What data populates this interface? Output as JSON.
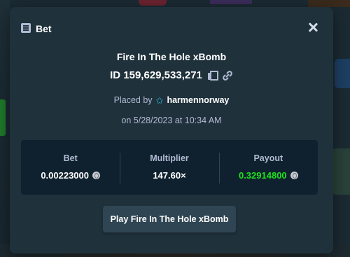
{
  "modal": {
    "title": "Bet",
    "game_name": "Fire In The Hole xBomb",
    "bet_id": "ID 159,629,533,271",
    "placed_by_prefix": "Placed by",
    "username": "harmennorway",
    "date_text": "on 5/28/2023 at 10:34 AM"
  },
  "stats": [
    {
      "label": "Bet",
      "value": "0.00223000",
      "icon": "coin-icon"
    },
    {
      "label": "Multiplier",
      "value": "147.60×"
    },
    {
      "label": "Payout",
      "value": "0.32914800",
      "icon": "coin-icon"
    }
  ],
  "play_button_label": "Play Fire In The Hole xBomb",
  "colors": {
    "modal_bg": "#1f313b",
    "stats_bg": "#0f212e",
    "muted_text": "#b1bad3",
    "payout_green": "#1fe11f",
    "star_blue": "#2ab6df",
    "button_bg": "#2f4553"
  },
  "icons": [
    "bet-slip-icon",
    "close-icon",
    "copy-icon",
    "link-icon",
    "star-icon",
    "coin-icon"
  ]
}
